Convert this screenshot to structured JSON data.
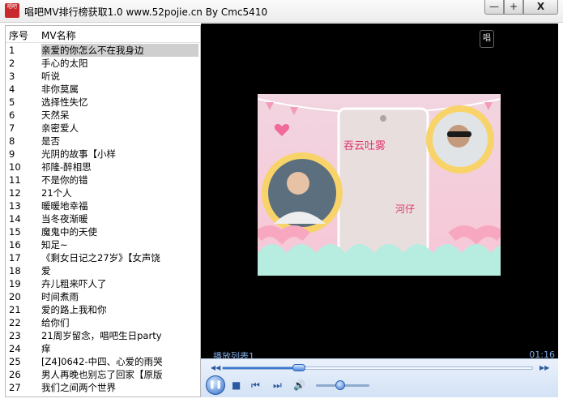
{
  "window": {
    "title": "唱吧MV排行榜获取1.0 www.52pojie.cn   By Cmc5410",
    "logo_text": "唱吧",
    "controls": {
      "minimize": "—",
      "maximize": "+",
      "close": "X"
    }
  },
  "playlist": {
    "columns": [
      "序号",
      "MV名称"
    ],
    "selected_index": 0,
    "rows": [
      {
        "idx": "1",
        "name": "亲爱的你怎么不在我身边"
      },
      {
        "idx": "2",
        "name": "手心的太阳"
      },
      {
        "idx": "3",
        "name": "听说"
      },
      {
        "idx": "4",
        "name": "非你莫属"
      },
      {
        "idx": "5",
        "name": "选择性失忆"
      },
      {
        "idx": "6",
        "name": "天然呆"
      },
      {
        "idx": "7",
        "name": "亲密爱人"
      },
      {
        "idx": "8",
        "name": "是否"
      },
      {
        "idx": "9",
        "name": "光阴的故事【小样"
      },
      {
        "idx": "10",
        "name": "祁隆-醉相思"
      },
      {
        "idx": "11",
        "name": "不是你的错"
      },
      {
        "idx": "12",
        "name": "21个人"
      },
      {
        "idx": "13",
        "name": "暖暖地幸福"
      },
      {
        "idx": "14",
        "name": "当冬夜渐暖"
      },
      {
        "idx": "15",
        "name": "魔鬼中的天使"
      },
      {
        "idx": "16",
        "name": "知足~"
      },
      {
        "idx": "17",
        "name": "《剩女日记之27岁》【女声饶"
      },
      {
        "idx": "18",
        "name": "爱"
      },
      {
        "idx": "19",
        "name": "卉儿粗来吓人了"
      },
      {
        "idx": "20",
        "name": "时间煮雨"
      },
      {
        "idx": "21",
        "name": "爱的路上我和你"
      },
      {
        "idx": "22",
        "name": "给你们"
      },
      {
        "idx": "23",
        "name": "21周岁留念，唱吧生日party"
      },
      {
        "idx": "24",
        "name": "痒"
      },
      {
        "idx": "25",
        "name": "[Z4]0642-中四、心爱的雨哭"
      },
      {
        "idx": "26",
        "name": "男人再晚也别忘了回家【原版"
      },
      {
        "idx": "27",
        "name": "我们之间两个世界"
      }
    ]
  },
  "player": {
    "chat_icon_text": "唱",
    "video_text_1": "吞云吐雾",
    "video_text_2": "河仔",
    "playlist_label": "播放列表1",
    "time": "01:16",
    "seek_progress": 0.245,
    "volume": 0.45,
    "icons": [
      "play-pause-icon",
      "stop-icon",
      "previous-icon",
      "next-icon",
      "volume-icon"
    ],
    "colors": {
      "accent": "#3a78d4",
      "overlay_text": "#7fa8e6",
      "video_text": "#e0336f"
    }
  }
}
